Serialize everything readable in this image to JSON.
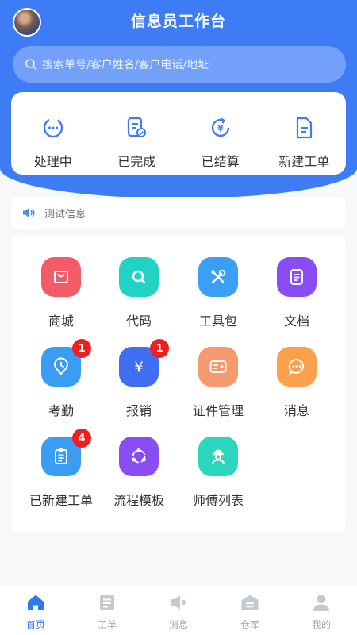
{
  "header": {
    "title": "信息员工作台"
  },
  "search": {
    "placeholder": "搜索单号/客户姓名/客户电话/地址"
  },
  "status": [
    {
      "label": "处理中",
      "icon": "processing-icon"
    },
    {
      "label": "已完成",
      "icon": "completed-icon"
    },
    {
      "label": "已结算",
      "icon": "settled-icon"
    },
    {
      "label": "新建工单",
      "icon": "new-order-icon"
    }
  ],
  "notice": {
    "text": "测试信息",
    "icon": "speaker-icon"
  },
  "grid": [
    {
      "label": "商城",
      "icon": "shop-icon",
      "color": "#f45b69"
    },
    {
      "label": "代码",
      "icon": "search-icon",
      "color": "#22d3c5"
    },
    {
      "label": "工具包",
      "icon": "tools-icon",
      "color": "#3aa0f5"
    },
    {
      "label": "文档",
      "icon": "document-icon",
      "color": "#8a4df4"
    },
    {
      "label": "考勤",
      "icon": "attendance-icon",
      "color": "#3b9cf3",
      "badge": "1"
    },
    {
      "label": "报销",
      "icon": "reimburse-icon",
      "color": "#3f6ff0",
      "badge": "1"
    },
    {
      "label": "证件管理",
      "icon": "id-card-icon",
      "color": "#f49a6e"
    },
    {
      "label": "消息",
      "icon": "message-icon",
      "color": "#fba04b"
    },
    {
      "label": "已新建工单",
      "icon": "clipboard-icon",
      "color": "#3b9cf3",
      "badge": "4"
    },
    {
      "label": "流程模板",
      "icon": "workflow-icon",
      "color": "#8a4df4"
    },
    {
      "label": "师傅列表",
      "icon": "worker-icon",
      "color": "#2ad6bd"
    }
  ],
  "tabbar": [
    {
      "label": "首页",
      "icon": "home-icon",
      "active": true
    },
    {
      "label": "工单",
      "icon": "orders-icon"
    },
    {
      "label": "消息",
      "icon": "messages-icon"
    },
    {
      "label": "仓库",
      "icon": "warehouse-icon"
    },
    {
      "label": "我的",
      "icon": "profile-icon"
    }
  ],
  "colors": {
    "brand": "#3d7cf5",
    "tab_active": "#2f78f0",
    "badge": "#f01e1e"
  }
}
